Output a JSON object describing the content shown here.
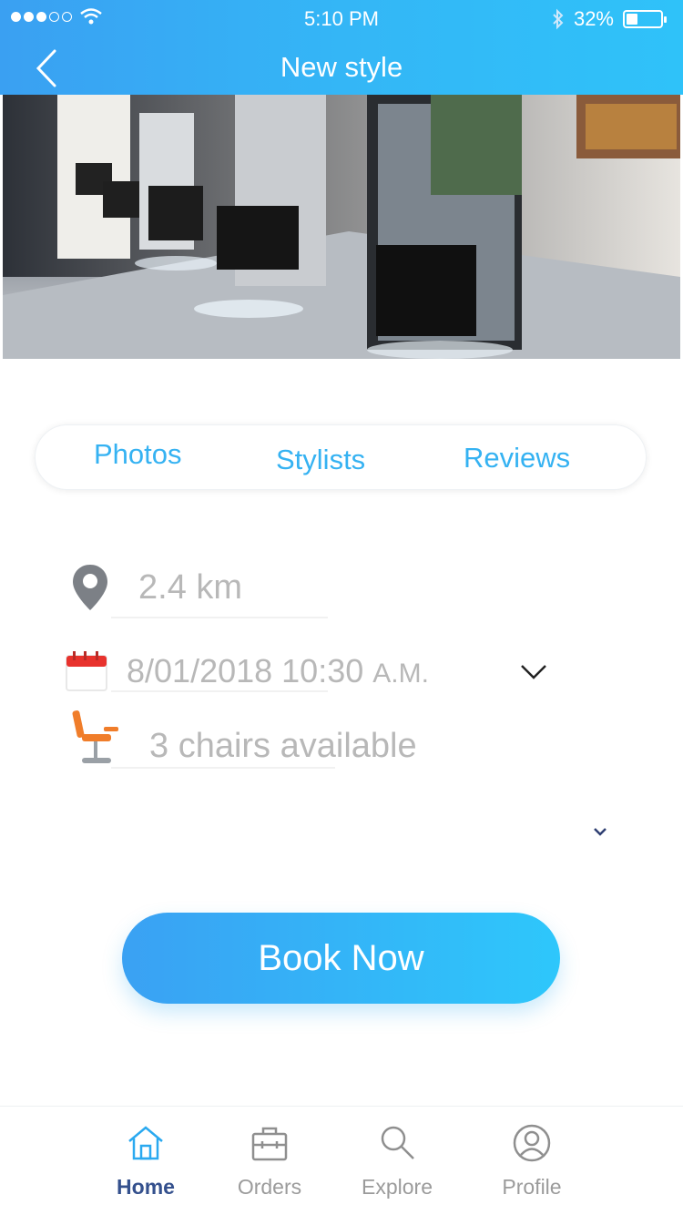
{
  "status_bar": {
    "time": "5:10 PM",
    "battery": "32%"
  },
  "header": {
    "title": "New style"
  },
  "hero": {
    "image": "salon-interior-photo"
  },
  "tabs": [
    {
      "label": "Photos"
    },
    {
      "label": "Stylists"
    },
    {
      "label": "Reviews"
    }
  ],
  "details": {
    "distance": "2.4 km",
    "datetime": "8/01/2018 10:30",
    "datetime_suffix": "A.M.",
    "chairs": "3 chairs available"
  },
  "book_button": {
    "label": "Book Now"
  },
  "tab_bar": [
    {
      "label": "Home",
      "icon": "home-icon",
      "active": true
    },
    {
      "label": "Orders",
      "icon": "briefcase-icon",
      "active": false
    },
    {
      "label": "Explore",
      "icon": "search-icon",
      "active": false
    },
    {
      "label": "Profile",
      "icon": "profile-icon",
      "active": false
    }
  ],
  "colors": {
    "accent": "#35b2f2",
    "active_nav": "#34508d",
    "muted": "#b8b8b8"
  }
}
